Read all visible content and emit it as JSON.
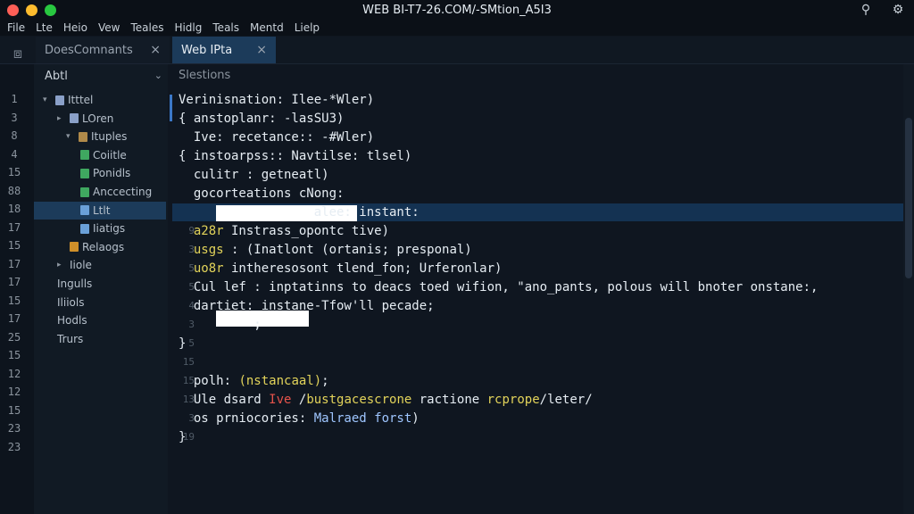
{
  "window": {
    "title": "WEB BI-T7-26.COM/-SMtion_A5I3",
    "traffic_colors": [
      "#ff5f57",
      "#febc2e",
      "#28c840"
    ]
  },
  "menu": [
    "File",
    "Lte",
    "Heio",
    "Vew",
    "Teales",
    "Hidlg",
    "Teals",
    "Mentd",
    "Lielp"
  ],
  "tabs": [
    {
      "label": "DoesComnants",
      "close": "×"
    },
    {
      "label": "Web IPta",
      "close": "×"
    }
  ],
  "sidebar": {
    "header": "Abtl",
    "gutter_numbers": [
      "1",
      "3",
      "8",
      "4",
      "15",
      "88",
      "18",
      "17",
      "15",
      "17",
      "17",
      "15",
      "17",
      "25",
      "15",
      "12",
      "12",
      "15",
      "23",
      "23"
    ],
    "items": [
      {
        "label": "Itttel",
        "twisty": "▾",
        "color": "#8aa0c8"
      },
      {
        "label": "LOren",
        "twisty": "▸",
        "color": "#8aa0c8"
      },
      {
        "label": "Ituples",
        "twisty": "▾",
        "color": "#b08a4a"
      },
      {
        "label": "Coiitle",
        "twisty": "",
        "color": "#3fa860"
      },
      {
        "label": "Ponidls",
        "twisty": "",
        "color": "#3fa860"
      },
      {
        "label": "Anccecting",
        "twisty": "",
        "color": "#3fa860"
      },
      {
        "label": "Ltlt",
        "twisty": "",
        "color": "#6aa0d8"
      },
      {
        "label": "Iiatigs",
        "twisty": "",
        "color": "#6aa0d8"
      },
      {
        "label": "Relaogs",
        "twisty": "",
        "color": "#d0902a"
      },
      {
        "label": "Iiole",
        "twisty": "▸",
        "color": ""
      },
      {
        "label": "Ingulls",
        "twisty": "",
        "color": ""
      },
      {
        "label": "Iliiols",
        "twisty": "",
        "color": ""
      },
      {
        "label": "Hodls",
        "twisty": "",
        "color": ""
      },
      {
        "label": "Trurs",
        "twisty": "",
        "color": ""
      }
    ]
  },
  "editor": {
    "header": "Slestions",
    "line_numbers": [
      "9",
      "3",
      "5",
      "5",
      "4",
      "3",
      "5",
      "15",
      "15",
      "13",
      "3",
      "19"
    ],
    "lines": [
      {
        "t": "Verinisnation: Ilee-*Wler)"
      },
      {
        "t": "{ anstoplanr: -lasSU3)"
      },
      {
        "t": "  Ive: recetance:: -#Wler)"
      },
      {
        "t": "{ instoarpss:: Navtilse: tlsel)"
      },
      {
        "t": "  culitr : getneatl)"
      },
      {
        "t": "  gocorteations cNong:"
      },
      {
        "t": "                  alee: instant:"
      },
      {
        "y": "  a28r",
        "t": " Instrass_opontc tive)"
      },
      {
        "y": "  usgs",
        "t": " : (Inatlont (ortanis; presponal)"
      },
      {
        "y": "  uo8r",
        "t": " intheresosont tlend_fon; Urferonlar)"
      },
      {
        "t": "  Cul lef : inptatinns to deacs toed wifion, \"ano_pants, polous will bnoter onstane:,"
      },
      {
        "t": "  dartiet: instane-Tfow'll pecade;"
      },
      {
        "t": "          ;"
      },
      {
        "t": "}"
      },
      {
        "t": ""
      },
      {
        "t": "  polh: ",
        "y2": "(nstancaal)",
        "t2": ";"
      },
      {
        "t": "  Ule dsard ",
        "r": "Ive",
        "t2": " /",
        "y2": "bustgacescrone",
        "t3": " ractione ",
        "y3": "rcprope",
        "t4": "/leter/"
      },
      {
        "t": "  os prniocories: ",
        "b": "Malraed forst",
        "t2": ")"
      },
      {
        "t": "}"
      }
    ]
  }
}
